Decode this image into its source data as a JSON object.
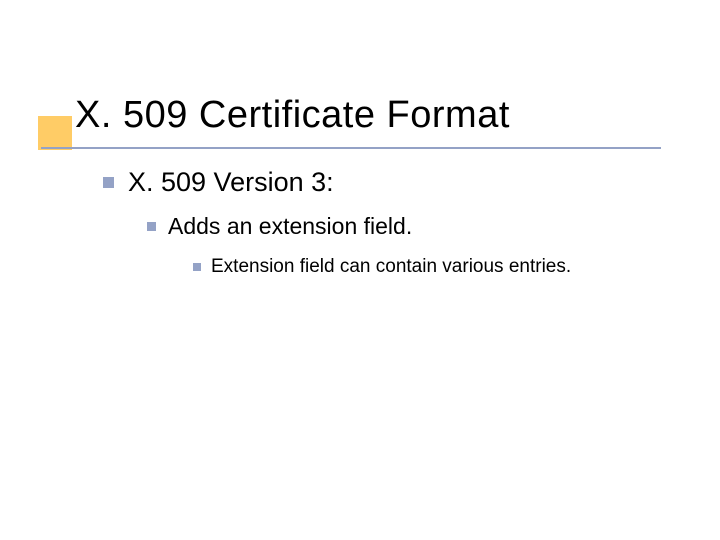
{
  "title": "X. 509 Certificate Format",
  "bullets": {
    "lvl1": "X. 509 Version 3:",
    "lvl2": "Adds an extension field.",
    "lvl3": "Extension field can contain various entries."
  }
}
